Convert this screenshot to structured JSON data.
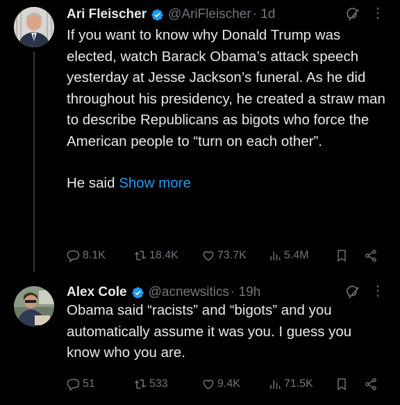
{
  "posts": [
    {
      "author_name": "Ari Fleischer",
      "handle": "@AriFleischer",
      "time": "· 1d",
      "paragraphs": [
        "If you want to know why Donald Trump was elected, watch Barack Obama’s attack speech yesterday at Jesse Jackson’s funeral. As he did throughout his presidency, he created a straw man to describe Republicans as bigots who force the American people to “turn on each other”.",
        "He said"
      ],
      "show_more": "Show more",
      "replies": "8.1K",
      "reposts": "18.4K",
      "likes": "73.7K",
      "views": "5.4M",
      "more_icon": "⋮"
    },
    {
      "author_name": "Alex Cole",
      "handle": "@acnewsitics",
      "time": "· 19h",
      "paragraphs": [
        "Obama said “racists” and “bigots” and you automatically assume it was you. I guess you know who you are."
      ],
      "replies": "51",
      "reposts": "533",
      "likes": "9.4K",
      "views": "71.5K",
      "more_icon": "⋮"
    }
  ],
  "colors": {
    "background": "#000000",
    "text": "#e7e9ea",
    "secondary": "#71767b",
    "link": "#1d9bf0",
    "verified": "#1d9bf0"
  },
  "icons": [
    "verified-badge-icon",
    "grok-icon",
    "more-icon",
    "reply-icon",
    "repost-icon",
    "like-icon",
    "views-icon",
    "bookmark-icon",
    "share-icon"
  ]
}
